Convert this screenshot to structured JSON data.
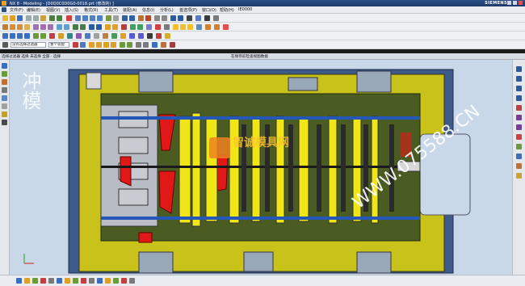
{
  "app": {
    "title": "NX 8 - Modeling - [D0Q0C0D0G0-0018.prt  (修改的) ]",
    "brand": "SIEMENS"
  },
  "menu": {
    "items": [
      "文件(F)",
      "编辑(E)",
      "视图(V)",
      "插入(S)",
      "格式(R)",
      "工具(T)",
      "装配(A)",
      "信息(I)",
      "分析(L)",
      "首选项(P)",
      "窗口(O)",
      "帮助(H)",
      "IE0000"
    ]
  },
  "toolbar": {
    "filter_value": "没有选择过滤器",
    "scope_value": "整个装配"
  },
  "tabs": {
    "left_label": "选择过滤器 选择 未选择 全部 · 选择",
    "center_label": "在保存前检查视图数据"
  },
  "watermarks": {
    "left_text": "冲模",
    "center_text": "智诚模具网",
    "diagonal_text": "WWW.075588.CN"
  },
  "colors": {
    "accent_blue": "#1d3a6a",
    "model_plate": "#c9c21a",
    "model_frame": "#4a5c22",
    "part_red": "#e01818",
    "part_yellow": "#f0e616",
    "part_silver": "#b8bcc4",
    "part_blue": "#2358b8"
  }
}
